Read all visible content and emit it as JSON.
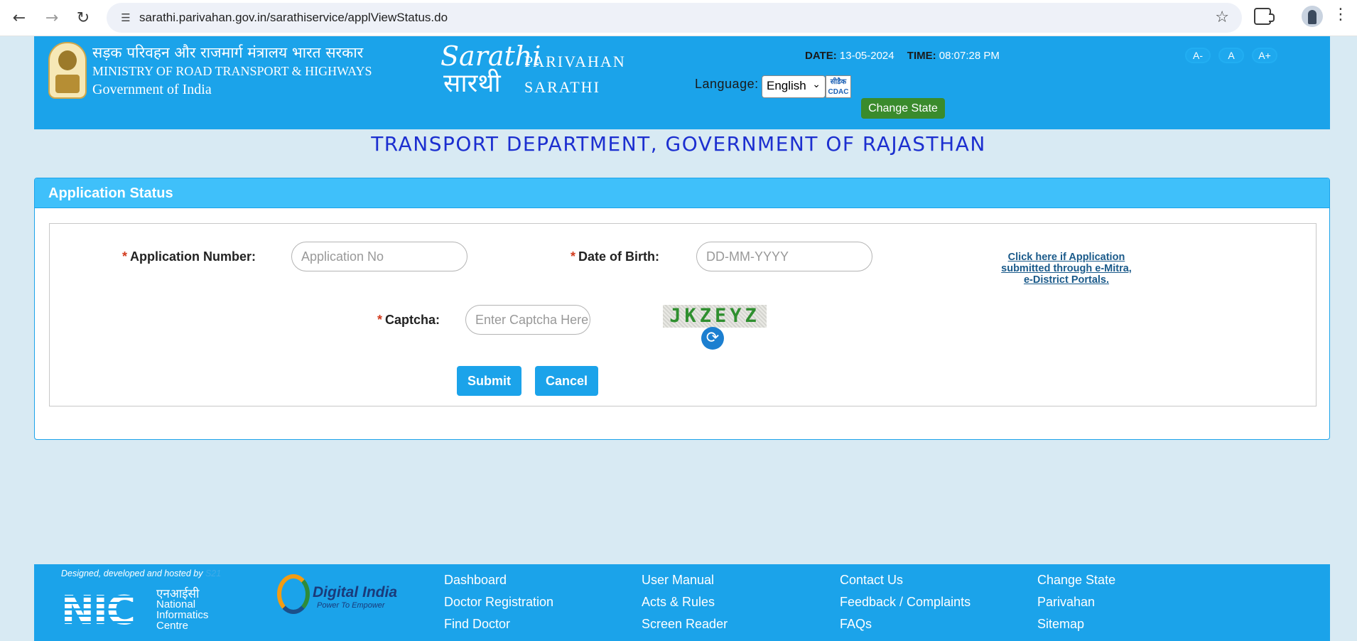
{
  "browser": {
    "url": "sarathi.parivahan.gov.in/sarathiservice/applViewStatus.do"
  },
  "header": {
    "ministry_hindi": "सड़क परिवहन और राजमार्ग मंत्रालय भारत सरकार",
    "ministry_english": "MINISTRY OF ROAD TRANSPORT & HIGHWAYS",
    "government": "Government of India",
    "logo_sarathi_en": "Sarathi",
    "logo_sarathi_hi": "सारथी",
    "parivahan": "PARIVAHAN",
    "sarathi": "SARATHI",
    "date_label": "DATE:",
    "date_value": "13-05-2024",
    "time_label": "TIME:",
    "time_value": "08:07:28 PM",
    "font_decrease": "A-",
    "font_normal": "A",
    "font_increase": "A+",
    "language_label": "Language:",
    "language_value": "English",
    "cdac_label": "सीडैक CDAC",
    "change_state": "Change State"
  },
  "department_title": "TRANSPORT DEPARTMENT, GOVERNMENT OF RAJASTHAN",
  "panel": {
    "title": "Application Status",
    "application_number_label": "Application Number:",
    "application_number_placeholder": "Application No",
    "dob_label": "Date of Birth:",
    "dob_placeholder": "DD-MM-YYYY",
    "emitra_link": "Click here if Application submitted through e-Mitra, e-District Portals.",
    "captcha_label": "Captcha:",
    "captcha_placeholder": "Enter Captcha Here",
    "captcha_text": "JKZEYZ",
    "submit": "Submit",
    "cancel": "Cancel",
    "required_marker": "*"
  },
  "footer": {
    "designed_by": "Designed, developed and hosted by",
    "designed_by_link": "S21",
    "nic_big": "NIC",
    "nic_hindi": "एनआईसी",
    "nic_name_1": "National",
    "nic_name_2": "Informatics",
    "nic_name_3": "Centre",
    "digital_india": "Digital India",
    "digital_india_tagline": "Power To Empower",
    "links_col1": [
      "Dashboard",
      "Doctor Registration",
      "Find Doctor"
    ],
    "links_col2": [
      "User Manual",
      "Acts & Rules",
      "Screen Reader"
    ],
    "links_col3": [
      "Contact Us",
      "Feedback / Complaints",
      "FAQs"
    ],
    "links_col4": [
      "Change State",
      "Parivahan",
      "Sitemap"
    ]
  },
  "colors": {
    "header_blue": "#1ba3ea",
    "panel_head": "#3fc0fa",
    "title_blue": "#1c2fd0",
    "change_state_green": "#3a8b2c"
  }
}
